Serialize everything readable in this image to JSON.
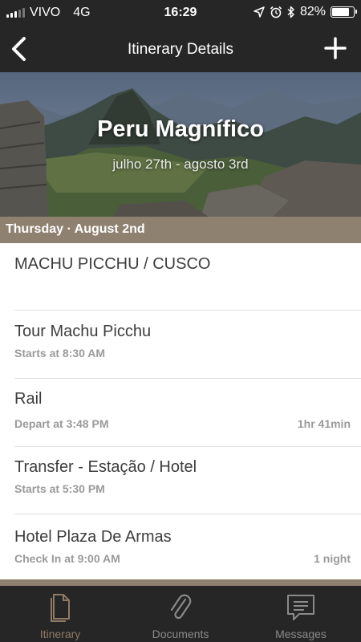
{
  "status_bar": {
    "carrier": "VIVO",
    "network": "4G",
    "time": "16:29",
    "battery_percent": "82%",
    "battery_level": 0.82
  },
  "nav": {
    "title": "Itinerary Details"
  },
  "hero": {
    "title": "Peru Magnífico",
    "dates": "julho 27th - agosto 3rd"
  },
  "day_header": "Thursday · August 2nd",
  "section_title": "MACHU PICCHU / CUSCO",
  "items": [
    {
      "title": "Tour Machu Picchu",
      "subtitle": "Starts at 8:30 AM",
      "right": ""
    },
    {
      "title": "Rail",
      "subtitle": "Depart at 3:48 PM",
      "right": "1hr 41min"
    },
    {
      "title": "Transfer - Estação / Hotel",
      "subtitle": "Starts at 5:30 PM",
      "right": ""
    },
    {
      "title": "Hotel Plaza De Armas",
      "subtitle": "Check In at 9:00 AM",
      "right": "1 night"
    }
  ],
  "tabs": [
    {
      "label": "Itinerary",
      "icon": "document-icon",
      "active": true
    },
    {
      "label": "Documents",
      "icon": "paperclip-icon",
      "active": false
    },
    {
      "label": "Messages",
      "icon": "message-icon",
      "active": false
    }
  ],
  "colors": {
    "bar_background": "#262626",
    "accent": "#8f8170",
    "active_tab": "#8f7a64"
  }
}
